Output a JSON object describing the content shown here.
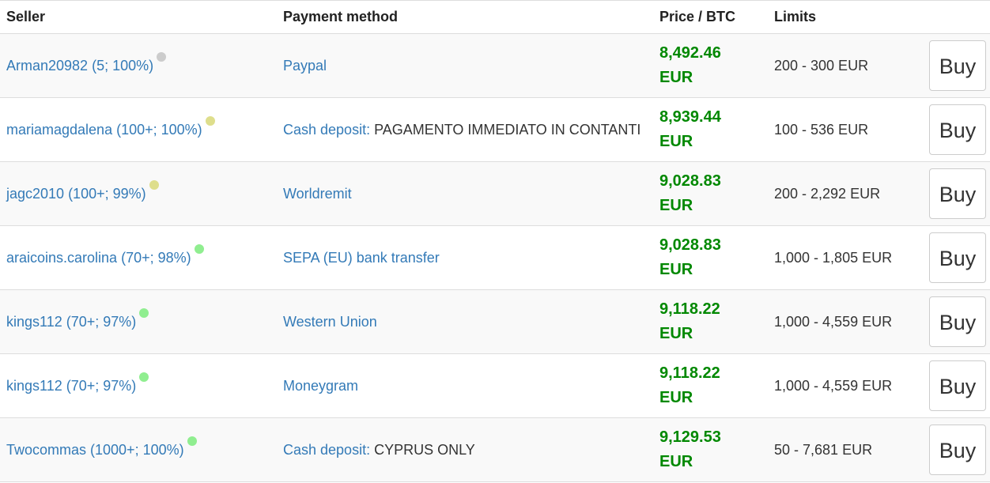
{
  "columns": {
    "seller": "Seller",
    "payment": "Payment method",
    "price": "Price / BTC",
    "limits": "Limits"
  },
  "rows": [
    {
      "seller": "Arman20982 (5; 100%)",
      "dot_color": "#cccccc",
      "method": "Paypal",
      "method_note": "",
      "price": "8,492.46",
      "currency": "EUR",
      "limits": "200 - 300 EUR",
      "button": "Buy"
    },
    {
      "seller": "mariamagdalena (100+; 100%)",
      "dot_color": "#dede8c",
      "method": "Cash deposit:",
      "method_note": " PAGAMENTO IMMEDIATO IN CONTANTI",
      "price": "8,939.44",
      "currency": "EUR",
      "limits": "100 - 536 EUR",
      "button": "Buy"
    },
    {
      "seller": "jagc2010 (100+; 99%)",
      "dot_color": "#dede8c",
      "method": "Worldremit",
      "method_note": "",
      "price": "9,028.83",
      "currency": "EUR",
      "limits": "200 - 2,292 EUR",
      "button": "Buy"
    },
    {
      "seller": "araicoins.carolina (70+; 98%)",
      "dot_color": "#90ee90",
      "method": "SEPA (EU) bank transfer",
      "method_note": "",
      "price": "9,028.83",
      "currency": "EUR",
      "limits": "1,000 - 1,805 EUR",
      "button": "Buy"
    },
    {
      "seller": "kings112 (70+; 97%)",
      "dot_color": "#90ee90",
      "method": "Western Union",
      "method_note": "",
      "price": "9,118.22",
      "currency": "EUR",
      "limits": "1,000 - 4,559 EUR",
      "button": "Buy"
    },
    {
      "seller": "kings112 (70+; 97%)",
      "dot_color": "#90ee90",
      "method": "Moneygram",
      "method_note": "",
      "price": "9,118.22",
      "currency": "EUR",
      "limits": "1,000 - 4,559 EUR",
      "button": "Buy"
    },
    {
      "seller": "Twocommas (1000+; 100%)",
      "dot_color": "#90ee90",
      "method": "Cash deposit:",
      "method_note": " CYPRUS ONLY",
      "price": "9,129.53",
      "currency": "EUR",
      "limits": "50 - 7,681 EUR",
      "button": "Buy"
    }
  ],
  "colors": {
    "link": "#337ab7",
    "price": "#008800",
    "row_alt": "#f9f9f9"
  }
}
